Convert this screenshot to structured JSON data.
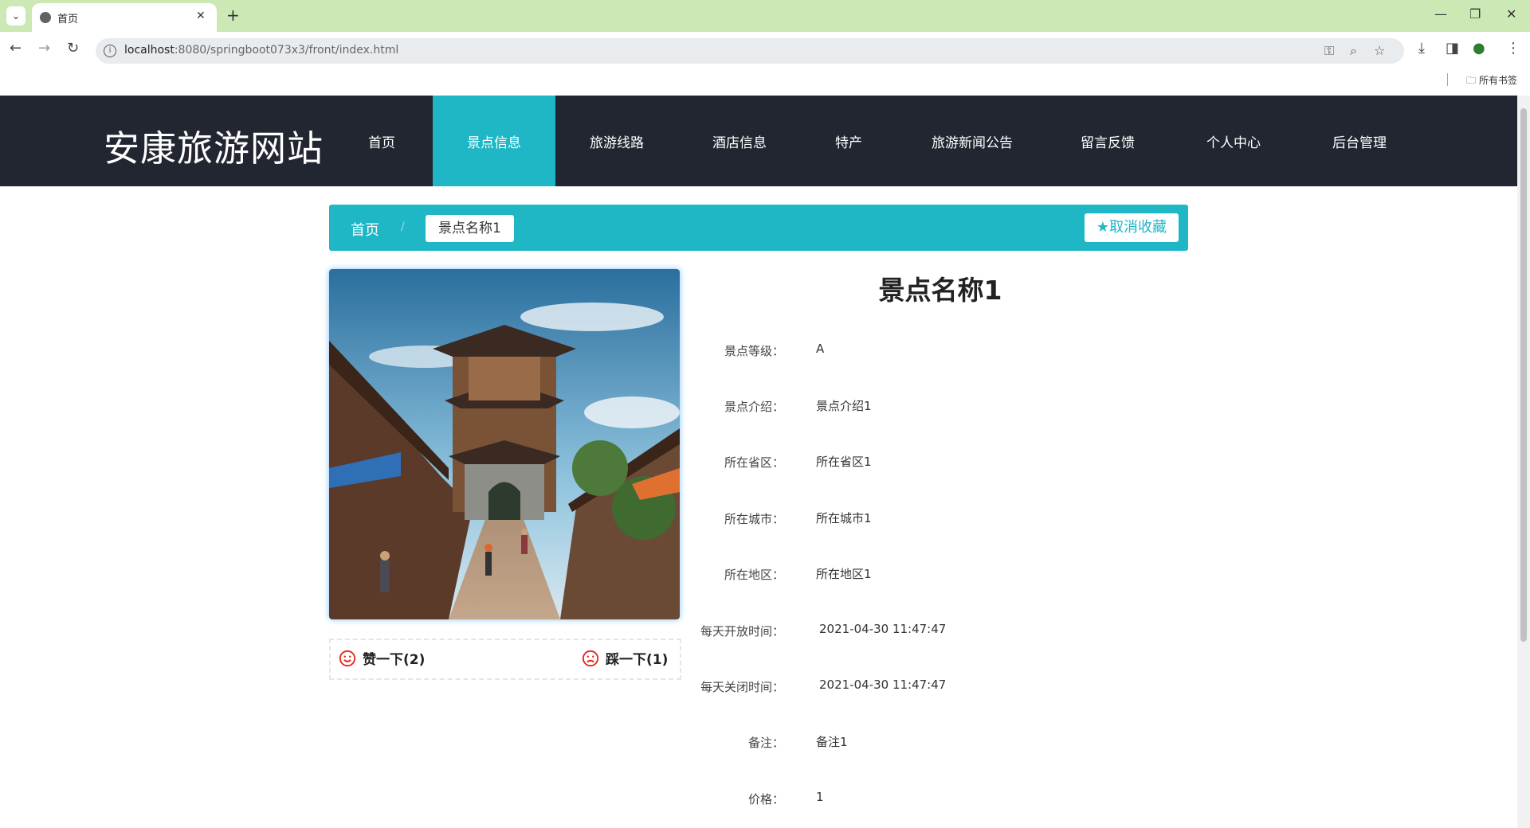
{
  "browser": {
    "tab_title": "首页",
    "url_host": "localhost",
    "url_rest": ":8080/springboot073x3/front/index.html",
    "bookmarks_label": "所有书签",
    "tab_bar_color": "#cce8b5"
  },
  "site": {
    "title": "安康旅游网站",
    "header_color": "#222630",
    "accent_color": "#1fb6c6",
    "nav": [
      {
        "label": "首页",
        "active": false
      },
      {
        "label": "景点信息",
        "active": true
      },
      {
        "label": "旅游线路",
        "active": false
      },
      {
        "label": "酒店信息",
        "active": false
      },
      {
        "label": "特产",
        "active": false
      },
      {
        "label": "旅游新闻公告",
        "active": false
      },
      {
        "label": "留言反馈",
        "active": false
      },
      {
        "label": "个人中心",
        "active": false
      },
      {
        "label": "后台管理",
        "active": false
      }
    ]
  },
  "breadcrumb": {
    "home": "首页",
    "separator": "/",
    "current": "景点名称1",
    "favorite_button": "取消收藏"
  },
  "detail": {
    "title": "景点名称1",
    "fields": [
      {
        "label": "景点等级：",
        "value": "A"
      },
      {
        "label": "景点介绍：",
        "value": "景点介绍1"
      },
      {
        "label": "所在省区：",
        "value": "所在省区1"
      },
      {
        "label": "所在城市：",
        "value": "所在城市1"
      },
      {
        "label": "所在地区：",
        "value": "所在地区1"
      },
      {
        "label": "每天开放时间：",
        "value": "2021-04-30 11:47:47"
      },
      {
        "label": "每天关闭时间：",
        "value": "2021-04-30 11:47:47"
      },
      {
        "label": "备注：",
        "value": "备注1"
      },
      {
        "label": "价格：",
        "value": "1"
      }
    ]
  },
  "votes": {
    "like": "赞一下(2)",
    "dislike": "踩一下(1)"
  }
}
